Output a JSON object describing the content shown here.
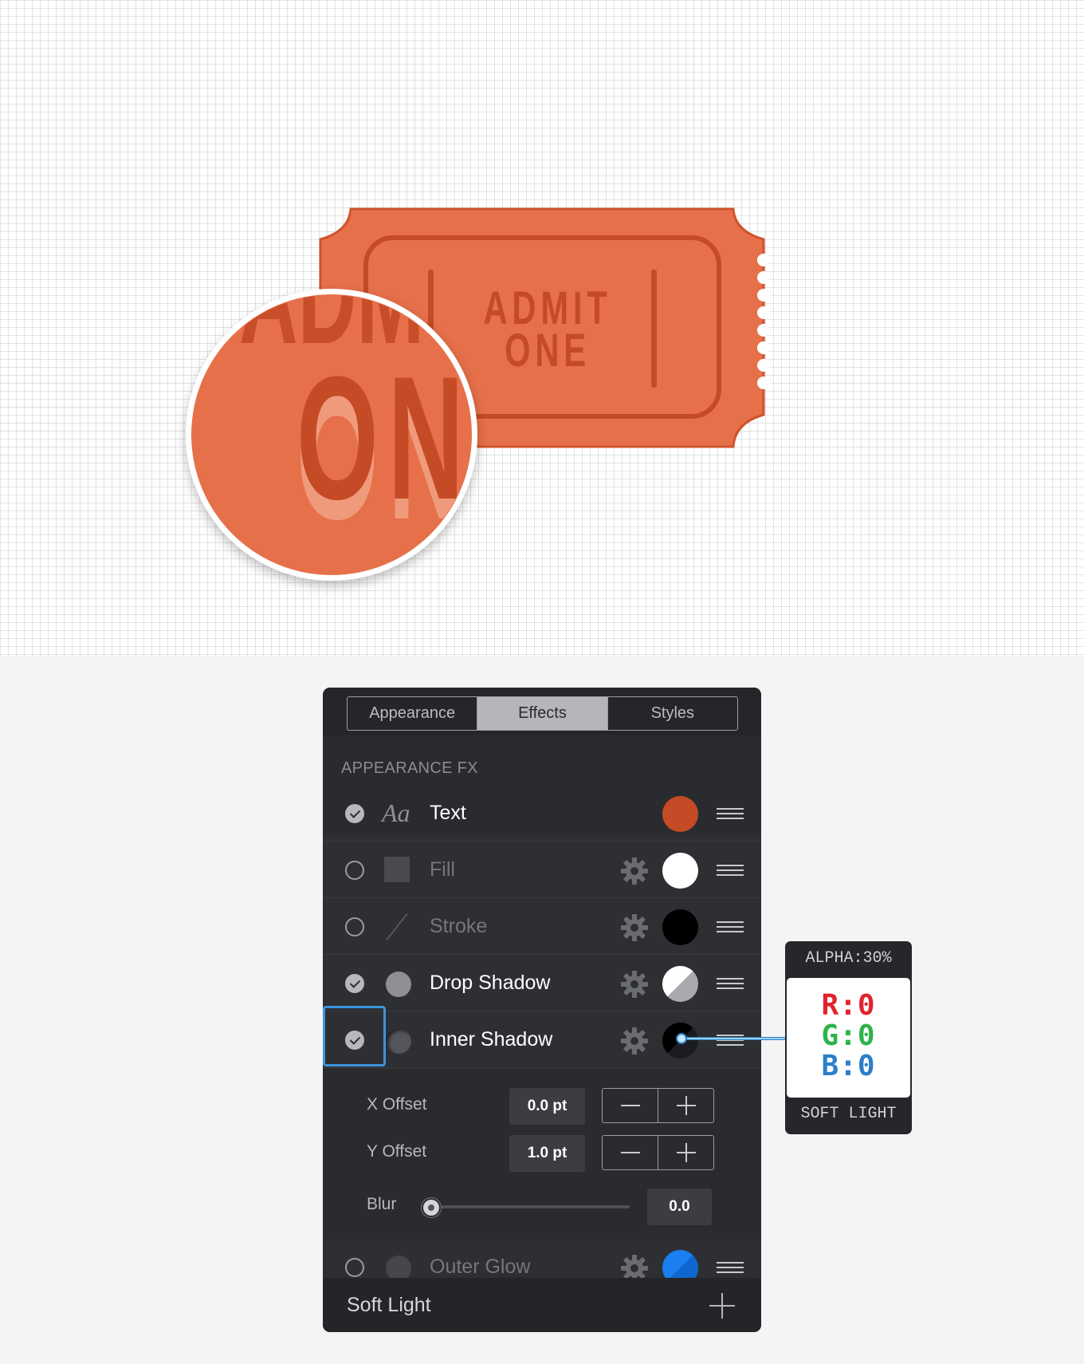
{
  "canvas": {
    "ticket": {
      "line1": "ADMIT",
      "line2": "ONE"
    },
    "magnifier": {
      "text": "ON"
    },
    "colors": {
      "ticket": "#e6704a",
      "ticket_dark": "#c44b25",
      "accent": "#2a7bc0"
    }
  },
  "panel": {
    "tabs": [
      {
        "label": "Appearance",
        "active": false
      },
      {
        "label": "Effects",
        "active": true
      },
      {
        "label": "Styles",
        "active": false
      }
    ],
    "section_title": "APPEARANCE FX",
    "rows": [
      {
        "label": "Text",
        "icon": "text-style-icon",
        "icon_glyph": "Aa",
        "enabled": true,
        "swatch": "#c44b25"
      },
      {
        "label": "Fill",
        "icon": "fill-square-icon",
        "enabled": false,
        "swatch": "#ffffff"
      },
      {
        "label": "Stroke",
        "icon": "stroke-line-icon",
        "enabled": false,
        "swatch": "#000000"
      },
      {
        "label": "Drop Shadow",
        "icon": "drop-shadow-icon",
        "enabled": true,
        "swatch": "white/gray split"
      },
      {
        "label": "Inner Shadow",
        "icon": "inner-shadow-icon",
        "enabled": true,
        "swatch": "#000000"
      },
      {
        "label": "Outer Glow",
        "icon": "outer-glow-icon",
        "enabled": false,
        "swatch": "#1a7ff0"
      }
    ],
    "options": {
      "x_offset": {
        "label": "X Offset",
        "value": "0.0 pt"
      },
      "y_offset": {
        "label": "Y Offset",
        "value": "1.0 pt"
      },
      "blur": {
        "label": "Blur",
        "value": "0.0",
        "level": 0
      }
    },
    "footer": {
      "blend_mode": "Soft Light"
    }
  },
  "callout": {
    "alpha": "ALPHA:30%",
    "r": "R:0",
    "g": "G:0",
    "b": "B:0",
    "blend": "SOFT LIGHT",
    "colors": {
      "r": "#e0242d",
      "g": "#2db34a",
      "b": "#2b7fc9"
    }
  }
}
